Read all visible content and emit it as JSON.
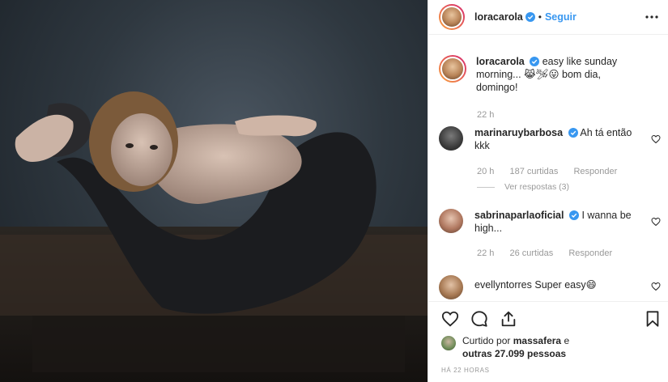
{
  "post": {
    "author": "loracarola",
    "follow_label": "Seguir",
    "separator": "•",
    "image_alt": "Photo of a woman posed with legs folded in dark stockings"
  },
  "caption": {
    "username": "loracarola",
    "text": "easy like sunday morning... 😹🛩😛 bom dia, domingo!",
    "time": "22 h"
  },
  "comments": [
    {
      "username": "marinaruybarbosa",
      "verified": true,
      "text": "Ah tá então kkk",
      "time": "20 h",
      "likes": "187 curtidas",
      "reply_label": "Responder",
      "view_replies": "Ver respostas (3)"
    },
    {
      "username": "sabrinaparlaoficial",
      "verified": true,
      "text": "I wanna be high...",
      "time": "22 h",
      "likes": "26 curtidas",
      "reply_label": "Responder"
    },
    {
      "username": "evellyntorres",
      "verified": false,
      "text": "Super easy😄"
    }
  ],
  "likes": {
    "prefix": "Curtido por",
    "user": "massafera",
    "conj": "e",
    "others": "outras 27.099 pessoas"
  },
  "timestamp": "HÁ 22 HORAS",
  "colors": {
    "accent": "#3897f0",
    "text": "#262626",
    "muted": "#999999",
    "border": "#efefef"
  },
  "icons": [
    "more-options-icon",
    "verified-badge-icon",
    "heart-icon",
    "comment-icon",
    "share-icon",
    "bookmark-icon"
  ]
}
